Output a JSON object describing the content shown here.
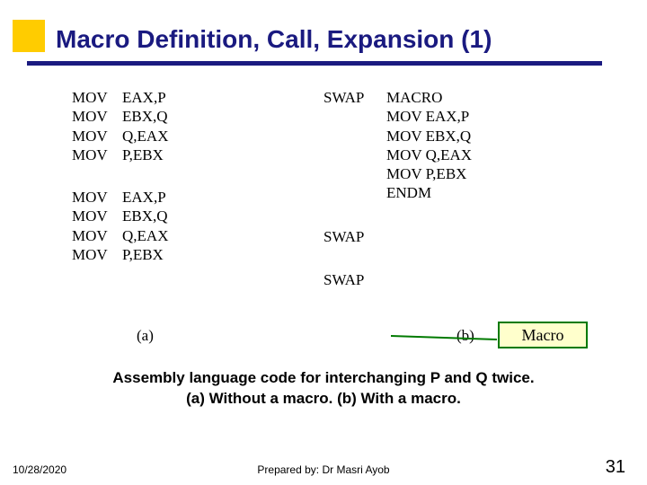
{
  "title": "Macro Definition, Call, Expansion (1)",
  "code": {
    "colA_block1": [
      {
        "op": "MOV",
        "arg": "EAX,P"
      },
      {
        "op": "MOV",
        "arg": "EBX,Q"
      },
      {
        "op": "MOV",
        "arg": "Q,EAX"
      },
      {
        "op": "MOV",
        "arg": "P,EBX"
      }
    ],
    "colA_block2": [
      {
        "op": "MOV",
        "arg": "EAX,P"
      },
      {
        "op": "MOV",
        "arg": "EBX,Q"
      },
      {
        "op": "MOV",
        "arg": "Q,EAX"
      },
      {
        "op": "MOV",
        "arg": "P,EBX"
      }
    ],
    "labelA": "(a)",
    "colB_macro": [
      {
        "lab": "SWAP",
        "arg": "MACRO"
      },
      {
        "lab": "",
        "arg": "MOV EAX,P"
      },
      {
        "lab": "",
        "arg": "MOV EBX,Q"
      },
      {
        "lab": "",
        "arg": "MOV Q,EAX"
      },
      {
        "lab": "",
        "arg": "MOV P,EBX"
      },
      {
        "lab": "",
        "arg": "ENDM"
      }
    ],
    "colB_call1": "SWAP",
    "colB_call2": "SWAP",
    "labelB": "(b)"
  },
  "callout_label": "Macro",
  "caption_line1": "Assembly language code for interchanging P and Q twice.",
  "caption_line2": "(a) Without a macro.      (b) With a macro.",
  "footer": {
    "date": "10/28/2020",
    "prepared": "Prepared by: Dr Masri Ayob",
    "page": "31"
  }
}
